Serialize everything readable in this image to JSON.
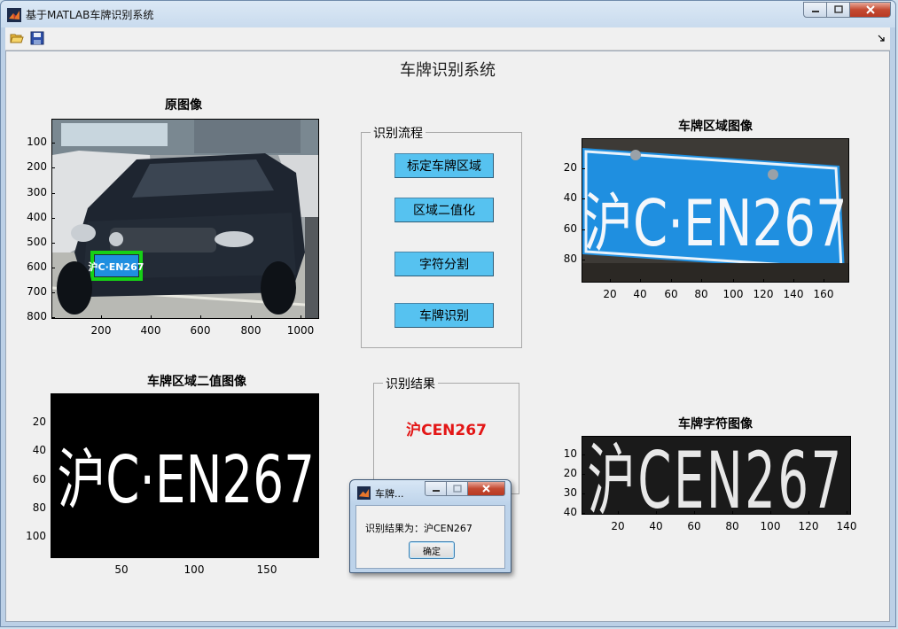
{
  "window": {
    "title": "基于MATLAB车牌识别系统"
  },
  "figure": {
    "title": "车牌识别系统"
  },
  "axes": {
    "original": {
      "title": "原图像",
      "yticks": [
        "100",
        "200",
        "300",
        "400",
        "500",
        "600",
        "700",
        "800"
      ],
      "xticks": [
        "200",
        "400",
        "600",
        "800",
        "1000"
      ],
      "plate_text": "沪C·EN267"
    },
    "plate_region": {
      "title": "车牌区域图像",
      "yticks": [
        "20",
        "40",
        "60",
        "80"
      ],
      "xticks": [
        "20",
        "40",
        "60",
        "80",
        "100",
        "120",
        "140",
        "160"
      ],
      "plate_text": "沪C·EN267"
    },
    "binary": {
      "title": "车牌区域二值图像",
      "yticks": [
        "20",
        "40",
        "60",
        "80",
        "100"
      ],
      "xticks": [
        "50",
        "100",
        "150"
      ],
      "plate_text": "沪C·EN267"
    },
    "chars": {
      "title": "车牌字符图像",
      "yticks": [
        "10",
        "20",
        "30",
        "40"
      ],
      "xticks": [
        "20",
        "40",
        "60",
        "80",
        "100",
        "120",
        "140"
      ],
      "plate_text": "沪CEN267"
    }
  },
  "process_panel": {
    "title": "识别流程",
    "buttons": [
      "标定车牌区域",
      "区域二值化",
      "字符分割",
      "车牌识别"
    ]
  },
  "result_panel": {
    "title": "识别结果",
    "value": "沪CEN267"
  },
  "dialog": {
    "title": "车牌...",
    "message": "识别结果为：沪CEN267",
    "ok_label": "确定"
  },
  "colors": {
    "button": "#56c2f0",
    "result": "#e31616",
    "plate_blue": "#1f8fe0",
    "green_box": "#16d016"
  }
}
